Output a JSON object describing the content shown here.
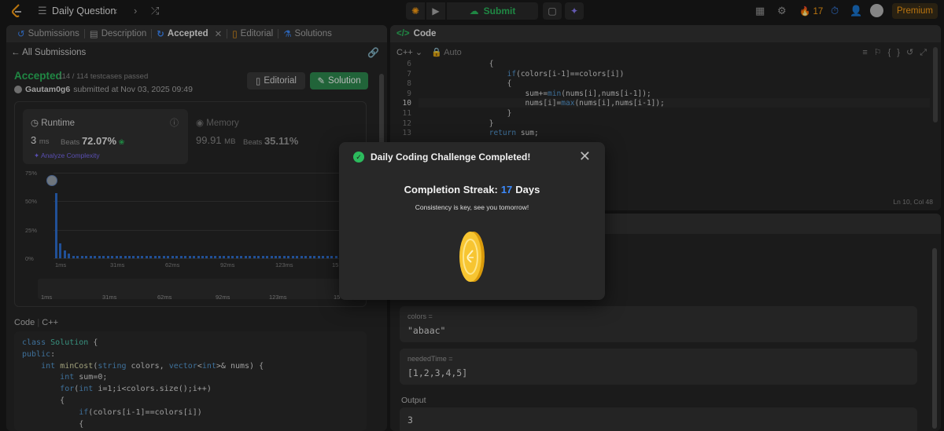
{
  "topbar": {
    "title": "Daily Question",
    "submit_label": "Submit",
    "streak_count": "17",
    "premium_label": "Premium"
  },
  "left": {
    "tabs": [
      {
        "label": "Submissions"
      },
      {
        "label": "Description"
      },
      {
        "label": "Accepted"
      },
      {
        "label": "Editorial"
      },
      {
        "label": "Solutions"
      }
    ],
    "back_label": "All Submissions",
    "status": "Accepted",
    "testcases": "114 / 114 testcases passed",
    "user": "Gautam0g6",
    "submitted": "submitted at Nov 03, 2025 09:49",
    "editorial_btn": "Editorial",
    "solution_btn": "Solution",
    "runtime": {
      "label": "Runtime",
      "value": "3",
      "unit": "ms",
      "beats_label": "Beats",
      "beats": "72.07%",
      "analyze": "Analyze Complexity"
    },
    "memory": {
      "label": "Memory",
      "value": "99.91",
      "unit": "MB",
      "beats_label": "Beats",
      "beats": "35.11%"
    },
    "code_label": "Code",
    "code_lang": "C++",
    "code_lines": [
      "class Solution {",
      "public:",
      "    int minCost(string colors, vector<int>& nums) {",
      "        int sum=0;",
      "        for(int i=1;i<colors.size();i++)",
      "        {",
      "            if(colors[i-1]==colors[i])",
      "            {"
    ]
  },
  "chart_data": {
    "type": "bar",
    "yticks": [
      "75%",
      "50%",
      "25%",
      "0%"
    ],
    "xticks": [
      "1ms",
      "31ms",
      "62ms",
      "92ms",
      "123ms",
      "15"
    ],
    "ylim": [
      0,
      75
    ],
    "values": [
      57,
      13,
      7,
      4,
      2,
      2,
      2,
      2,
      2,
      2,
      2,
      2,
      2,
      2,
      2,
      2,
      2,
      2,
      2,
      2,
      2,
      2,
      2,
      2,
      2,
      2,
      2,
      2,
      2,
      2,
      2,
      2,
      2,
      2,
      2,
      2,
      2,
      2,
      2,
      2,
      2,
      2,
      2,
      2,
      2,
      2,
      2,
      2,
      2,
      2,
      2,
      2,
      2,
      2,
      2,
      2,
      2,
      2,
      2,
      2,
      2,
      2,
      2,
      2,
      2,
      2,
      2,
      2
    ],
    "highlight_index": 0,
    "bar_color": "#2f6fd1"
  },
  "editor": {
    "header": "Code",
    "lang": "C++",
    "mode": "Auto",
    "lines": [
      {
        "n": "6",
        "code": "        {"
      },
      {
        "n": "7",
        "code": "            if(colors[i-1]==colors[i])"
      },
      {
        "n": "8",
        "code": "            {"
      },
      {
        "n": "9",
        "code": "                sum+=min(nums[i],nums[i-1]);"
      },
      {
        "n": "10",
        "code": "                nums[i]=max(nums[i],nums[i-1]);"
      },
      {
        "n": "11",
        "code": "            }"
      },
      {
        "n": "12",
        "code": "        }"
      },
      {
        "n": "13",
        "code": "        return sum;"
      }
    ],
    "cursor": "Ln 10, Col 48"
  },
  "testcase": {
    "colors_label": "colors =",
    "colors_value": "\"abaac\"",
    "neededTime_label": "neededTime =",
    "neededTime_value": "[1,2,3,4,5]",
    "output_label": "Output",
    "output_value": "3"
  },
  "modal": {
    "title": "Daily Coding Challenge Completed!",
    "streak_label": "Completion Streak:",
    "streak_value": "17",
    "streak_unit": "Days",
    "message": "Consistency is key, see you tomorrow!"
  }
}
